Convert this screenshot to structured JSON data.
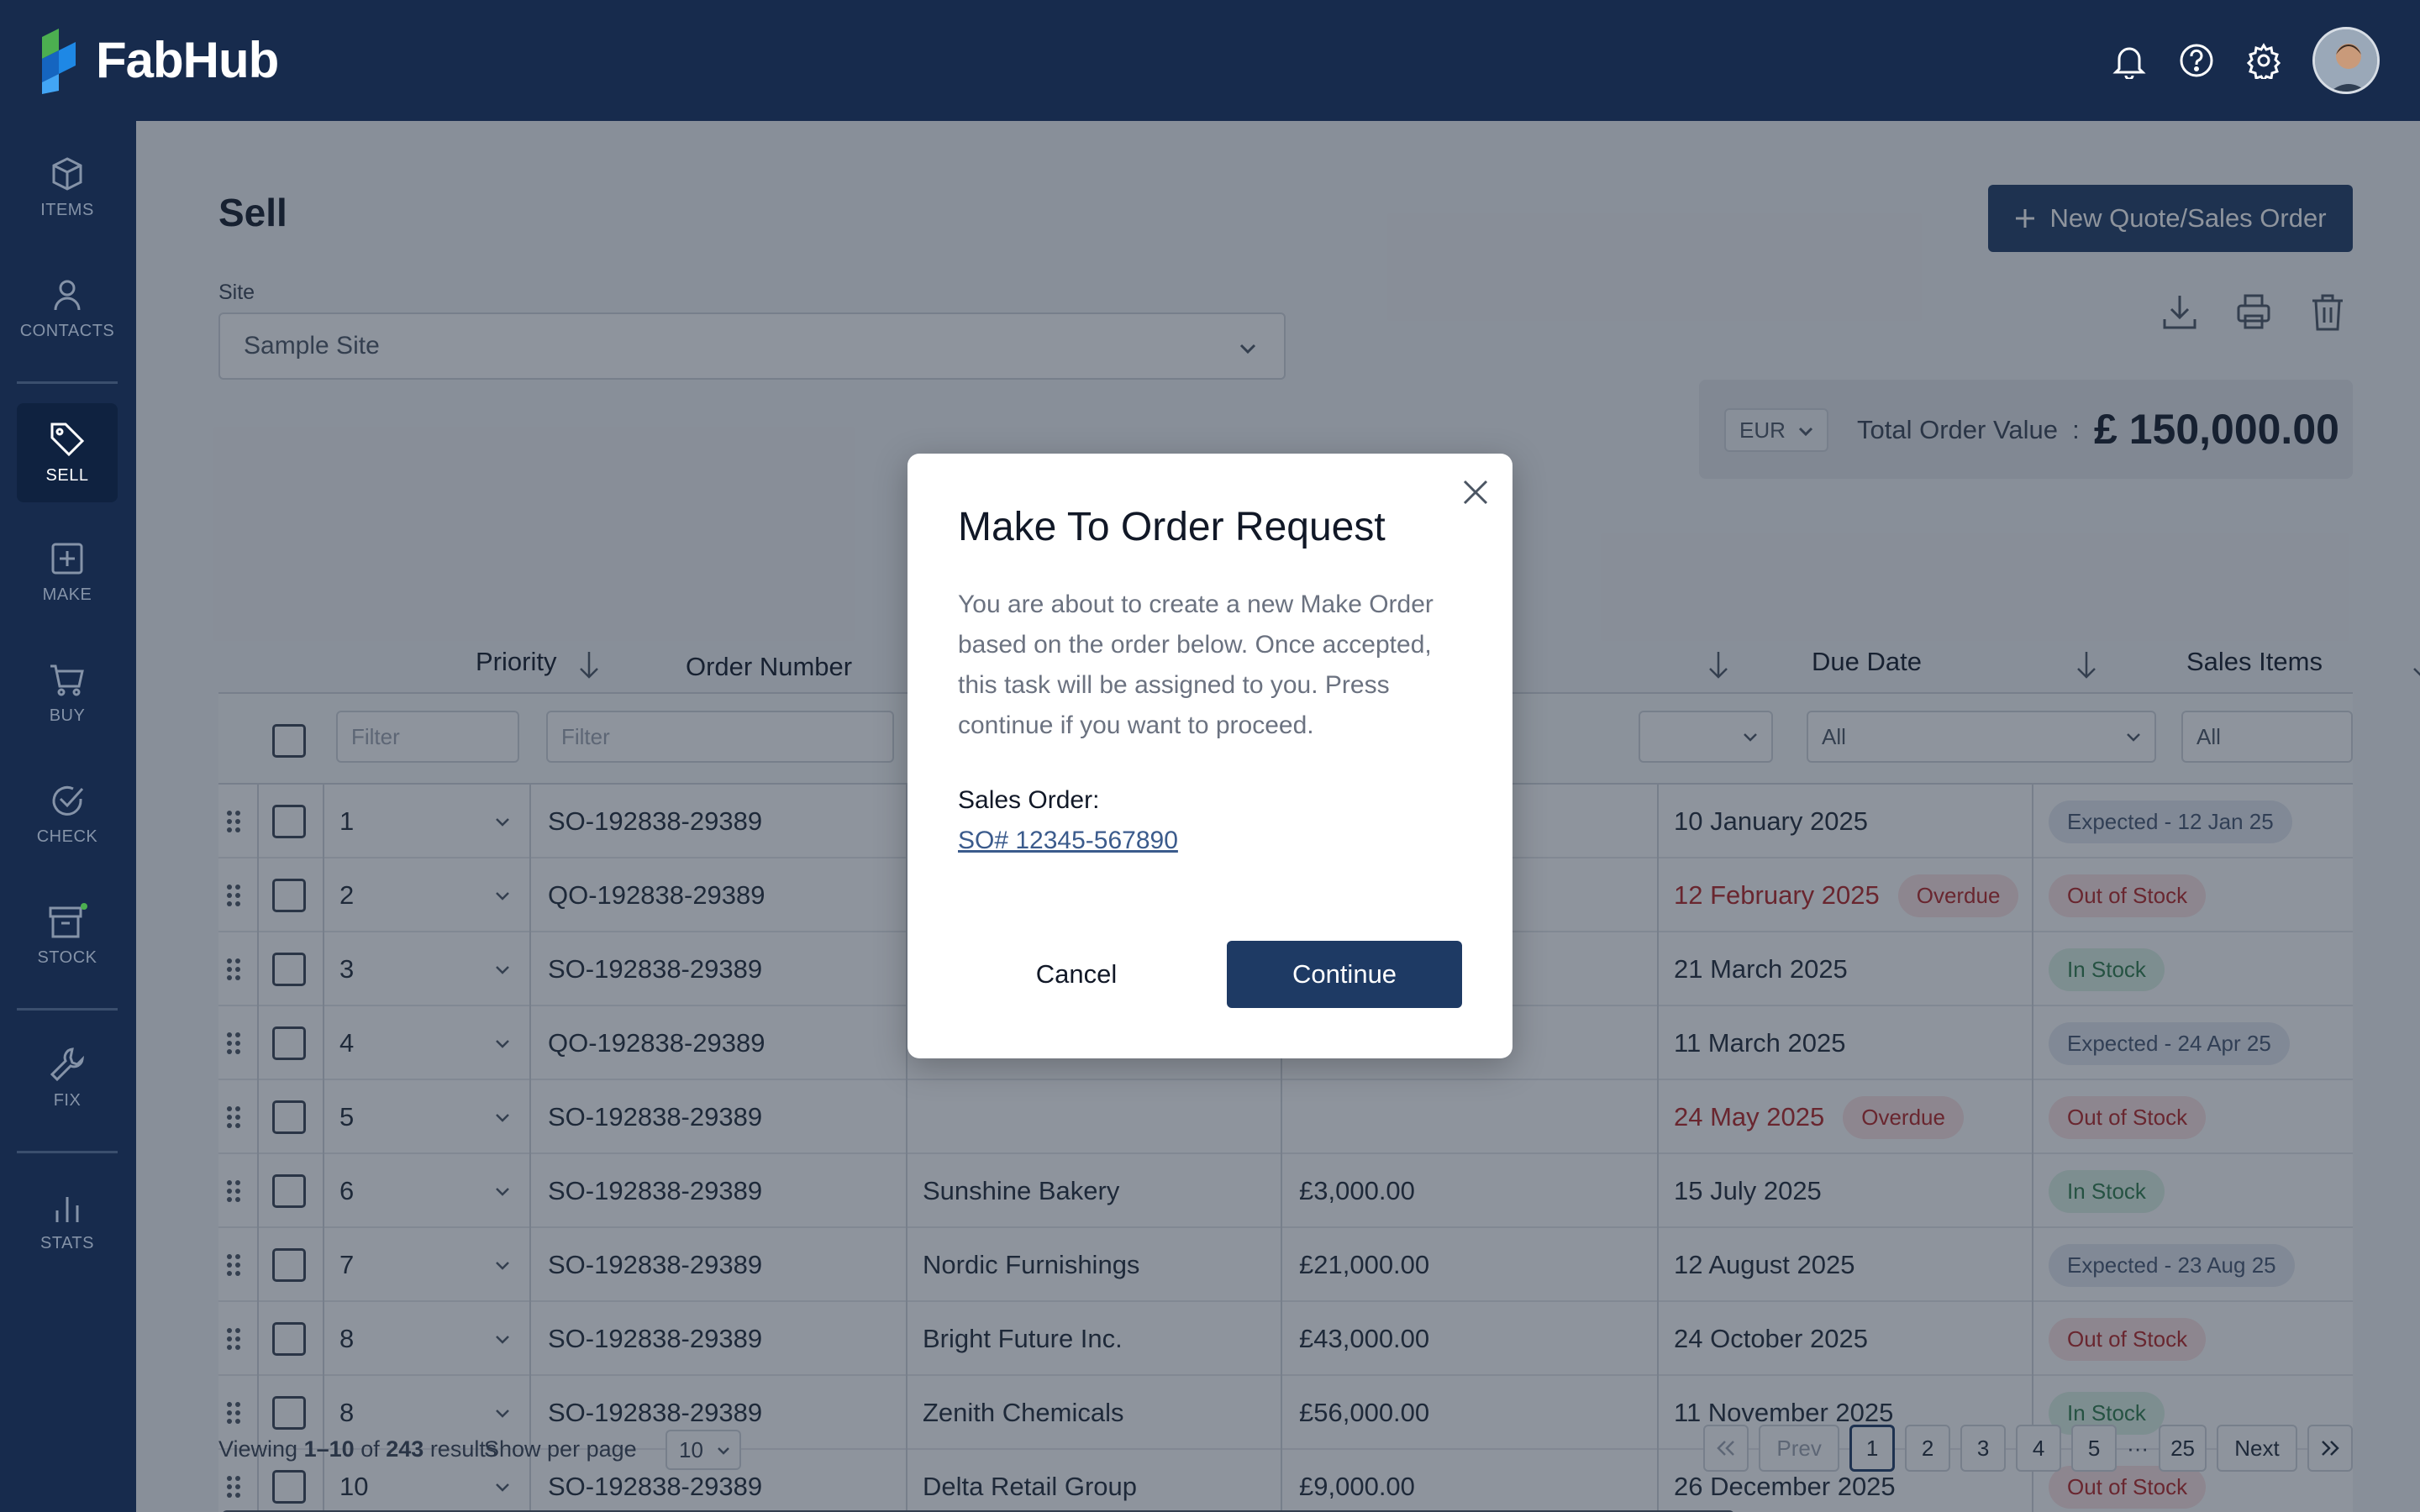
{
  "app": {
    "name": "FabHub"
  },
  "topbar": {
    "icons": [
      "bell-icon",
      "help-icon",
      "settings-icon"
    ]
  },
  "sidebar": {
    "items": [
      {
        "label": "ITEMS",
        "icon": "box-icon"
      },
      {
        "label": "CONTACTS",
        "icon": "person-icon"
      },
      {
        "label": "SELL",
        "icon": "tag-icon",
        "active": true
      },
      {
        "label": "MAKE",
        "icon": "plus-square-icon"
      },
      {
        "label": "BUY",
        "icon": "cart-icon"
      },
      {
        "label": "CHECK",
        "icon": "check-circle-icon"
      },
      {
        "label": "STOCK",
        "icon": "archive-icon"
      },
      {
        "label": "FIX",
        "icon": "wrench-icon"
      },
      {
        "label": "STATS",
        "icon": "bar-chart-icon"
      }
    ]
  },
  "page": {
    "title": "Sell",
    "new_button": "New Quote/Sales Order",
    "site_label": "Site",
    "site_value": "Sample Site",
    "currency": "EUR",
    "total_label": "Total Order Value",
    "total_colon": ":",
    "total_value": "£ 150,000.00"
  },
  "table": {
    "headers": {
      "priority": "Priority",
      "order_number": "Order Number",
      "due_date": "Due Date",
      "sales_items": "Sales Items"
    },
    "filters": {
      "priority": "Filter",
      "order_number": "Filter",
      "due_date": "All",
      "sales_items": "All"
    },
    "rows": [
      {
        "priority": "1",
        "order": "SO-192838-29389",
        "customer": "",
        "value": "",
        "due": "10 January 2025",
        "overdue": false,
        "status": "Expected - 12 Jan 25",
        "status_type": "exp"
      },
      {
        "priority": "2",
        "order": "QO-192838-29389",
        "customer": "",
        "value": "",
        "due": "12 February 2025",
        "overdue": true,
        "status": "Out of Stock",
        "status_type": "oos"
      },
      {
        "priority": "3",
        "order": "SO-192838-29389",
        "customer": "",
        "value": "",
        "due": "21 March 2025",
        "overdue": false,
        "status": "In Stock",
        "status_type": "in"
      },
      {
        "priority": "4",
        "order": "QO-192838-29389",
        "customer": "",
        "value": "",
        "due": "11 March 2025",
        "overdue": false,
        "status": "Expected - 24 Apr 25",
        "status_type": "exp"
      },
      {
        "priority": "5",
        "order": "SO-192838-29389",
        "customer": "",
        "value": "",
        "due": "24 May 2025",
        "overdue": true,
        "status": "Out of Stock",
        "status_type": "oos"
      },
      {
        "priority": "6",
        "order": "SO-192838-29389",
        "customer": "Sunshine Bakery",
        "value": "£3,000.00",
        "due": "15 July 2025",
        "overdue": false,
        "status": "In Stock",
        "status_type": "in"
      },
      {
        "priority": "7",
        "order": "SO-192838-29389",
        "customer": "Nordic Furnishings",
        "value": "£21,000.00",
        "due": "12 August 2025",
        "overdue": false,
        "status": "Expected - 23 Aug 25",
        "status_type": "exp"
      },
      {
        "priority": "8",
        "order": "SO-192838-29389",
        "customer": "Bright Future Inc.",
        "value": "£43,000.00",
        "due": "24 October 2025",
        "overdue": false,
        "status": "Out of Stock",
        "status_type": "oos"
      },
      {
        "priority": "8",
        "order": "SO-192838-29389",
        "customer": "Zenith Chemicals",
        "value": "£56,000.00",
        "due": "11 November 2025",
        "overdue": false,
        "status": "In Stock",
        "status_type": "in"
      },
      {
        "priority": "10",
        "order": "SO-192838-29389",
        "customer": "Delta Retail Group",
        "value": "£9,000.00",
        "due": "26 December 2025",
        "overdue": false,
        "status": "Out of Stock",
        "status_type": "oos"
      }
    ],
    "overdue_label": "Overdue"
  },
  "footer": {
    "viewing_prefix": "Viewing",
    "viewing_range": "1–10",
    "viewing_of": "of",
    "viewing_total": "243",
    "viewing_suffix": "results",
    "per_page_label": "Show per page",
    "per_page_value": "10",
    "prev": "Prev",
    "next": "Next",
    "pages": [
      "1",
      "2",
      "3",
      "4",
      "5"
    ],
    "ellipsis": "···",
    "last_page": "25"
  },
  "modal": {
    "title": "Make To Order Request",
    "body": "You are about to create a new Make Order based on the order below. Once accepted, this task will be assigned to you. Press continue if you want to proceed.",
    "so_label": "Sales Order:",
    "so_link": "SO# 12345-567890",
    "cancel": "Cancel",
    "continue": "Continue"
  }
}
